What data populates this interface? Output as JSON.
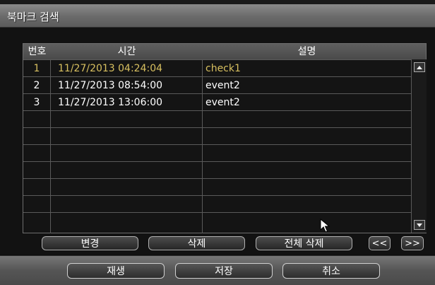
{
  "window": {
    "title": "북마크 검색"
  },
  "table": {
    "headers": {
      "num": "번호",
      "time": "시간",
      "desc": "설명"
    },
    "rows": [
      {
        "num": "1",
        "time": "11/27/2013  04:24:04",
        "desc": "check1"
      },
      {
        "num": "2",
        "time": "11/27/2013  08:54:00",
        "desc": "event2"
      },
      {
        "num": "3",
        "time": "11/27/2013  13:06:00",
        "desc": "event2"
      }
    ]
  },
  "actions": {
    "edit": "변경",
    "delete": "삭제",
    "delete_all": "전체 삭제",
    "prev": "<<",
    "next": ">>"
  },
  "footer": {
    "play": "재생",
    "save": "저장",
    "cancel": "취소"
  },
  "icons": {
    "scroll_up": "scroll-up-arrow-icon",
    "scroll_down": "scroll-down-arrow-icon",
    "cursor": "mouse-pointer-icon"
  },
  "colors": {
    "selected_row_text": "#d8c060"
  }
}
